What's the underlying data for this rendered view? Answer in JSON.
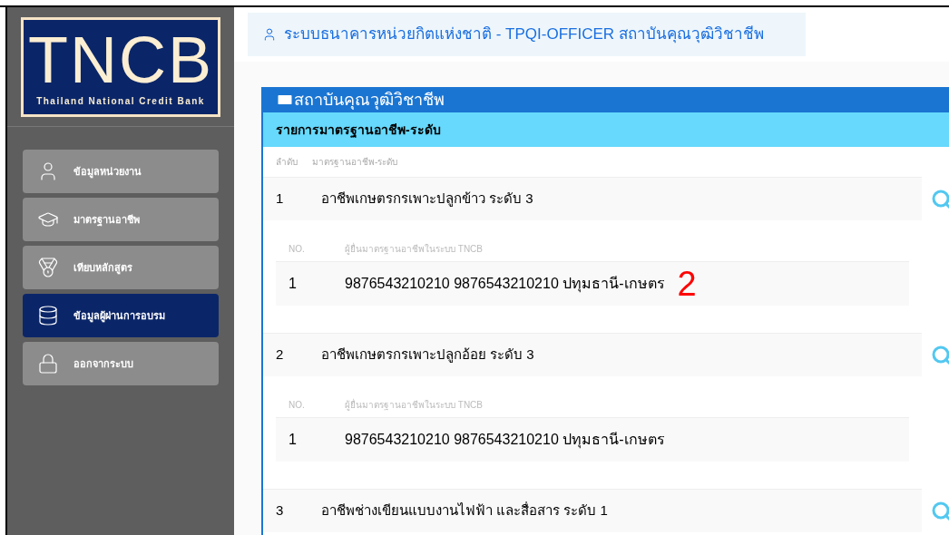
{
  "logo": {
    "title": "TNCB",
    "subtitle": "Thailand National Credit Bank"
  },
  "sidebar": {
    "items": [
      {
        "label": "ข้อมูลหน่วยงาน",
        "kind": "user",
        "selected": false
      },
      {
        "label": "มาตรฐานอาชีพ",
        "kind": "cap",
        "selected": false
      },
      {
        "label": "เทียบหลักสูตร",
        "kind": "medal",
        "selected": false
      },
      {
        "label": "ข้อมูลผู้ผ่านการอบรม",
        "kind": "database",
        "selected": true
      },
      {
        "label": "ออกจากระบบ",
        "kind": "lock",
        "selected": false
      }
    ]
  },
  "header": {
    "title": "ระบบธนาคารหน่วยกิตแห่งชาติ - TPQI-OFFICER สถาบันคุณวุฒิวิชาชีพ"
  },
  "card": {
    "title": "สถาบันคุณวุฒิวิชาชีพ",
    "subtitle": "รายการมาตรฐานอาชีพ-ระดับ",
    "columns": [
      "ลำดับ",
      "มาตรฐานอาชีพ-ระดับ"
    ],
    "rows": [
      {
        "no": "1",
        "name": "อาชีพเกษตรกรเพาะปลูกข้าว ระดับ 3",
        "sub_columns": [
          "NO.",
          "ผู้ยื่นมาตรฐานอาชีพในระบบ TNCB"
        ],
        "sub_rows": [
          {
            "no": "1",
            "text": "9876543210210 9876543210210 ปทุมธานี-เกษตร",
            "annotation": "2"
          }
        ]
      },
      {
        "no": "2",
        "name": "อาชีพเกษตรกรเพาะปลูกอ้อย ระดับ 3",
        "sub_columns": [
          "NO.",
          "ผู้ยื่นมาตรฐานอาชีพในระบบ TNCB"
        ],
        "sub_rows": [
          {
            "no": "1",
            "text": "9876543210210 9876543210210 ปทุมธานี-เกษตร"
          }
        ]
      },
      {
        "no": "3",
        "name": "อาชีพช่างเขียนแบบงานไฟฟ้า และสื่อสาร ระดับ 1"
      }
    ]
  }
}
